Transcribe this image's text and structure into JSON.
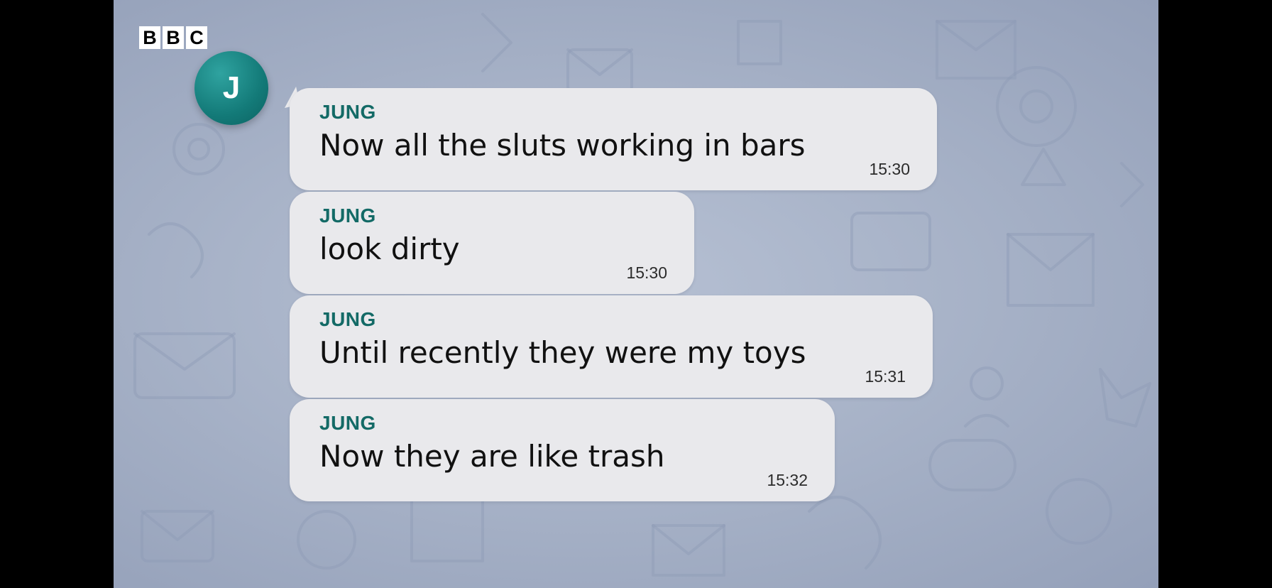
{
  "brand": {
    "letters": [
      "B",
      "B",
      "C"
    ]
  },
  "contact": {
    "initial": "J",
    "avatar_color": "#137a78"
  },
  "messages": [
    {
      "sender": "JUNG",
      "text": "Now all the sluts working in bars",
      "time": "15:30"
    },
    {
      "sender": "JUNG",
      "text": "look dirty",
      "time": "15:30"
    },
    {
      "sender": "JUNG",
      "text": "Until recently they were my toys",
      "time": "15:31"
    },
    {
      "sender": "JUNG",
      "text": "Now they are like trash",
      "time": "15:32"
    }
  ],
  "colors": {
    "sender_name": "#136a66",
    "bubble": "#e9e9ec",
    "chat_background": "#a8b3c8"
  }
}
